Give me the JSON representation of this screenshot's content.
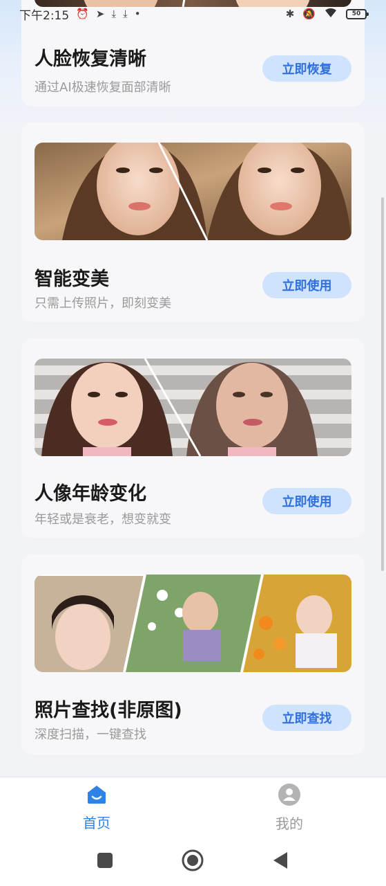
{
  "status_bar": {
    "time": "下午2:15",
    "battery": "50"
  },
  "cards": [
    {
      "title": "人脸恢复清晰",
      "subtitle": "通过AI极速恢复面部清晰",
      "button": "立即恢复"
    },
    {
      "title": "智能变美",
      "subtitle": "只需上传照片，即刻变美",
      "button": "立即使用"
    },
    {
      "title": "人像年龄变化",
      "subtitle": "年轻或是衰老，想变就变",
      "button": "立即使用"
    },
    {
      "title": "照片查找(非原图)",
      "subtitle": "深度扫描，一键查找",
      "button": "立即查找"
    }
  ],
  "tabs": {
    "home": "首页",
    "mine": "我的"
  },
  "colors": {
    "accent": "#2e82e6",
    "button_bg": "#cfe3fc",
    "button_text": "#2f6fe0"
  }
}
